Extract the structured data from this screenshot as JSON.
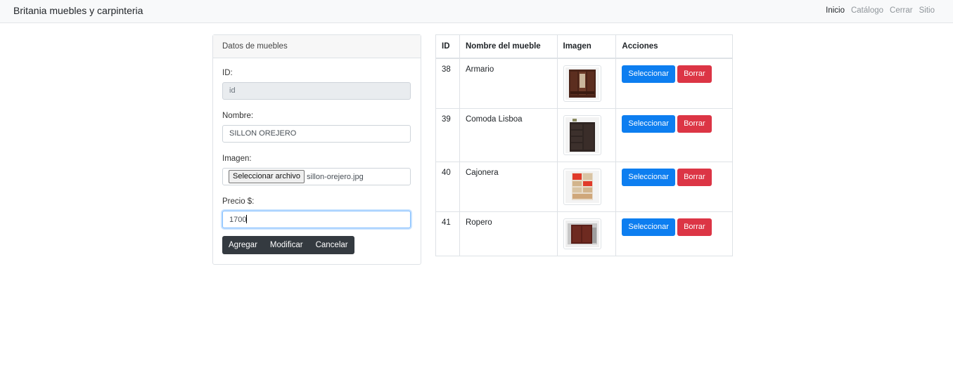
{
  "navbar": {
    "brand": "Britania muebles y carpinteria",
    "links": [
      "Inicio",
      "Catálogo",
      "Cerrar",
      "Sitio"
    ]
  },
  "form": {
    "header": "Datos de muebles",
    "id_label": "ID:",
    "id_placeholder": "id",
    "name_label": "Nombre:",
    "name_value": "SILLON OREJERO",
    "image_label": "Imagen:",
    "file_button": "Seleccionar archivo",
    "file_name": "sillon-orejero.jpg",
    "price_label": "Precio $:",
    "price_value": "1700",
    "buttons": {
      "add": "Agregar",
      "modify": "Modificar",
      "cancel": "Cancelar"
    }
  },
  "table": {
    "headers": [
      "ID",
      "Nombre del mueble",
      "Imagen",
      "Acciones"
    ],
    "rows": [
      {
        "id": "38",
        "name": "Armario",
        "image_icon": "wardrobe-icon"
      },
      {
        "id": "39",
        "name": "Comoda Lisboa",
        "image_icon": "dresser-icon"
      },
      {
        "id": "40",
        "name": "Cajonera",
        "image_icon": "drawers-icon"
      },
      {
        "id": "41",
        "name": "Ropero",
        "image_icon": "closet-icon"
      }
    ],
    "select_label": "Seleccionar",
    "delete_label": "Borrar"
  },
  "colors": {
    "primary": "#0d7ef0",
    "danger": "#dc3545",
    "dark": "#343a40",
    "navbar_bg": "#f8f9fa"
  }
}
